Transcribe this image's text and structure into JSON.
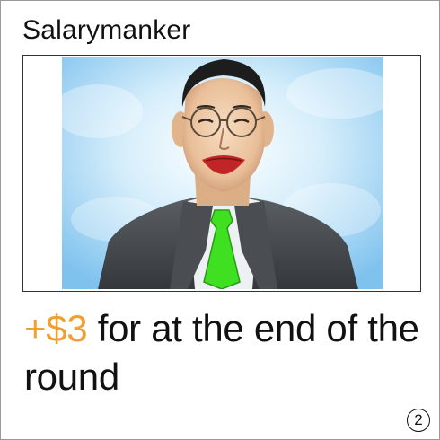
{
  "card": {
    "title": "Salarymanker",
    "effect_bonus": "+$3",
    "effect_text": " for at the end of the round",
    "number": "2",
    "colors": {
      "bonus": "#f0a030",
      "tie": "#3fe021",
      "suit": "#4a4e52",
      "sky": "#bfe3f7"
    },
    "art_icon": "salaryman-portrait"
  }
}
